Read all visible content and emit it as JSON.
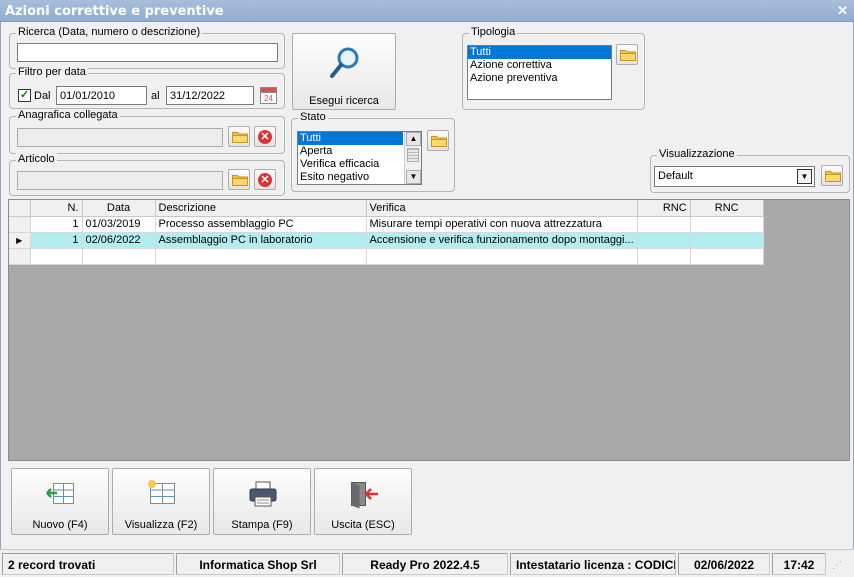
{
  "window": {
    "title": "Azioni correttive e preventive",
    "close_glyph": "✕"
  },
  "ricerca": {
    "legend": "Ricerca (Data, numero o descrizione)",
    "value": ""
  },
  "filtro_data": {
    "legend": "Filtro per data",
    "dal_checked": true,
    "dal_label": "Dal",
    "dal_value": "01/01/2010",
    "al_label": "al",
    "al_value": "31/12/2022",
    "calendar_day": "24"
  },
  "anagrafica": {
    "legend": "Anagrafica collegata",
    "value": ""
  },
  "articolo": {
    "legend": "Articolo",
    "value": ""
  },
  "search_button": {
    "label": "Esegui ricerca"
  },
  "tipologia": {
    "legend": "Tipologia",
    "items": [
      "Tutti",
      "Azione correttiva",
      "Azione preventiva"
    ],
    "selected": 0
  },
  "stato": {
    "legend": "Stato",
    "items": [
      "Tutti",
      "Aperta",
      "Verifica efficacia",
      "Esito negativo"
    ],
    "selected": 0
  },
  "visualizzazione": {
    "legend": "Visualizzazione",
    "value": "Default"
  },
  "grid": {
    "columns": [
      "N.",
      "Data",
      "Descrizione",
      "Verifica",
      "RNC",
      "RNC"
    ],
    "rows": [
      {
        "n": "1",
        "data": "01/03/2019",
        "descrizione": "Processo assemblaggio PC",
        "verifica": "Misurare tempi operativi con nuova attrezzatura",
        "rnc1": "",
        "rnc2": "",
        "current": false
      },
      {
        "n": "1",
        "data": "02/06/2022",
        "descrizione": "Assemblaggio PC in laboratorio",
        "verifica": "Accensione e verifica funzionamento dopo montaggi...",
        "rnc1": "",
        "rnc2": "",
        "current": true
      }
    ]
  },
  "buttons": {
    "nuovo": "Nuovo (F4)",
    "visualizza": "Visualizza (F2)",
    "stampa": "Stampa (F9)",
    "uscita": "Uscita (ESC)"
  },
  "status": {
    "records": "2 record trovati",
    "company": "Informatica Shop Srl",
    "version": "Ready Pro 2022.4.5",
    "license": "Intestatario licenza : CODICE",
    "date": "02/06/2022",
    "time": "17:42"
  },
  "colors": {
    "selection": "#0078d7",
    "row_highlight": "#b2edf0",
    "titlebar": "#a7bedb"
  }
}
